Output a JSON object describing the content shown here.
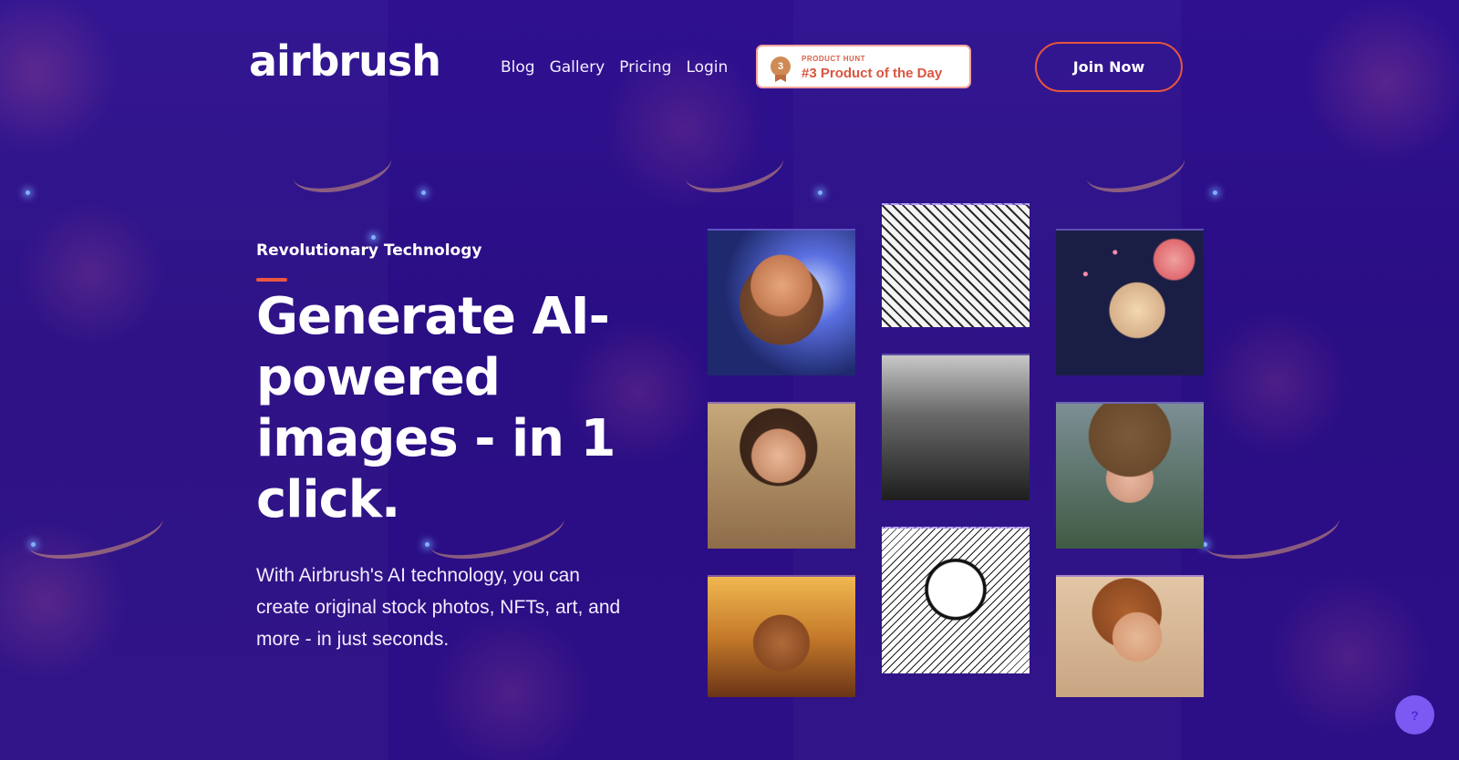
{
  "brand": {
    "logo_text": "airbrush"
  },
  "nav": {
    "items": [
      "Blog",
      "Gallery",
      "Pricing",
      "Login"
    ]
  },
  "product_hunt": {
    "overline": "PRODUCT HUNT",
    "title": "#3 Product of the Day",
    "medal_number": "3"
  },
  "header": {
    "join_label": "Join Now"
  },
  "hero": {
    "eyebrow": "Revolutionary Technology",
    "headline": "Generate AI-powered images - in 1 click.",
    "description": "With Airbrush's AI technology, you can create original stock photos, NFTs, art, and more - in just seconds."
  },
  "gallery": {
    "images": [
      "cartoon-hero-portrait",
      "manga-sketch-characters",
      "grumpy-cat-on-lips",
      "classical-woman-portrait",
      "black-white-room-scene",
      "woman-in-cowboy-hat",
      "golden-helmet-warrior",
      "ink-sketch-man-in-suit",
      "soft-painted-woman-profile"
    ]
  },
  "chat": {
    "icon": "chat-icon",
    "label": "?"
  },
  "colors": {
    "background": "#2a0f86",
    "accent": "#e5553e",
    "badge_text": "#da5540",
    "chat": "#7b59f2"
  }
}
